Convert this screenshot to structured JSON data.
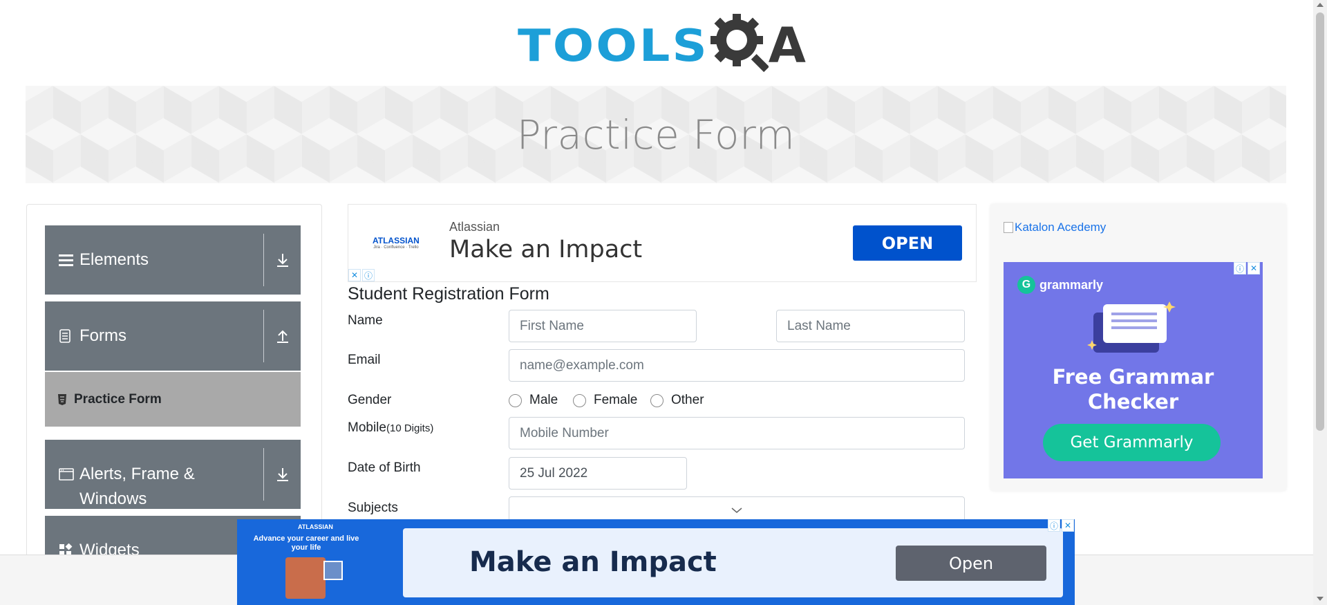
{
  "header": {
    "logo_text_left": "TOOLS",
    "logo_text_right": "A",
    "colors": {
      "tools": "#1d9fd8",
      "qa": "#3a3a3a"
    }
  },
  "banner": {
    "title": "Practice Form"
  },
  "sidebar": {
    "groups": [
      {
        "label": "Elements",
        "icon": "hamburger-icon",
        "toggle_icon": "download-arrow-icon"
      },
      {
        "label": "Forms",
        "icon": "document-icon",
        "toggle_icon": "upload-arrow-icon"
      },
      {
        "label": "Alerts, Frame & Windows",
        "icon": "window-icon",
        "toggle_icon": "download-arrow-icon"
      },
      {
        "label": "Widgets",
        "icon": "widgets-icon"
      }
    ],
    "active_item": {
      "label": "Practice Form",
      "icon": "html5-icon"
    }
  },
  "ad_top": {
    "brand": "ATLASSIAN",
    "brand_sub": "Jira · Confluence · Trello",
    "sponsor": "Atlassian",
    "headline": "Make an Impact",
    "button": "OPEN"
  },
  "form": {
    "title": "Student Registration Form",
    "name_label": "Name",
    "first_name_placeholder": "First Name",
    "last_name_placeholder": "Last Name",
    "email_label": "Email",
    "email_placeholder": "name@example.com",
    "gender_label": "Gender",
    "gender_options": [
      "Male",
      "Female",
      "Other"
    ],
    "mobile_label": "Mobile",
    "mobile_hint": "(10 Digits)",
    "mobile_placeholder": "Mobile Number",
    "dob_label": "Date of Birth",
    "dob_value": "25 Jul 2022",
    "subjects_label": "Subjects"
  },
  "right_ad": {
    "image_alt": "Katalon Acedemy",
    "grammarly_logo": "grammarly",
    "headline_line1": "Free Grammar",
    "headline_line2": "Checker",
    "button": "Get Grammarly"
  },
  "ad_bottom": {
    "brand": "ATLASSIAN",
    "tagline": "Advance your career and live your life",
    "headline": "Make an Impact",
    "button": "Open"
  }
}
